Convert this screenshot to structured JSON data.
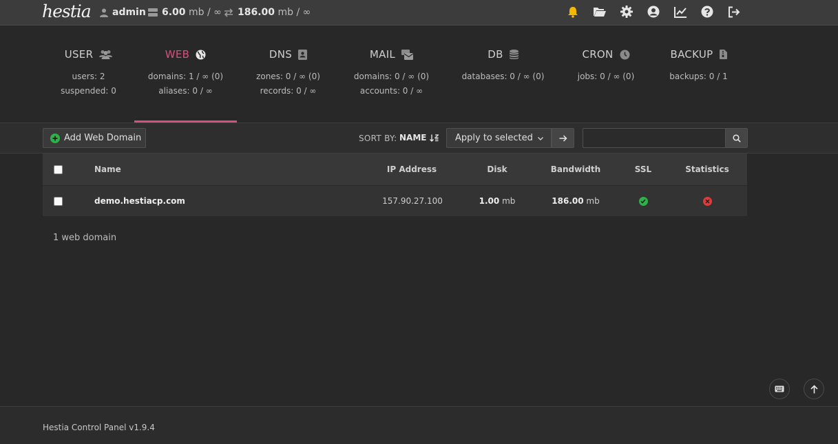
{
  "app": {
    "logo_text": "hestia",
    "footer": "Hestia Control Panel v1.9.4"
  },
  "topbar": {
    "user": "admin",
    "disk_value": "6.00",
    "disk_rest": "mb / ∞",
    "bandwidth_value": "186.00",
    "bandwidth_rest": "mb / ∞",
    "icons": [
      "bell-icon",
      "folder-open-icon",
      "gear-icon",
      "user-circle-icon",
      "chart-line-icon",
      "help-icon",
      "logout-icon"
    ],
    "bell_color": "#f5b700"
  },
  "tabs": [
    {
      "title": "USER",
      "lines": [
        "users: 2",
        "suspended: 0"
      ]
    },
    {
      "title": "WEB",
      "lines": [
        "domains: 1 / ∞ (0)",
        "aliases: 0 / ∞"
      ]
    },
    {
      "title": "DNS",
      "lines": [
        "zones: 0 / ∞ (0)",
        "records: 0 / ∞"
      ]
    },
    {
      "title": "MAIL",
      "lines": [
        "domains: 0 / ∞ (0)",
        "accounts: 0 / ∞"
      ]
    },
    {
      "title": "DB",
      "lines": [
        "databases: 0 / ∞ (0)"
      ]
    },
    {
      "title": "CRON",
      "lines": [
        "jobs: 0 / ∞ (0)"
      ]
    },
    {
      "title": "BACKUP",
      "lines": [
        "backups: 0 / 1"
      ]
    }
  ],
  "active_tab": "WEB",
  "accent_color": "#d94f7c",
  "toolbar": {
    "add_label": "Add Web Domain",
    "sort_label": "SORT BY:",
    "sort_value": "NAME",
    "bulk_action": "Apply to selected",
    "search_placeholder": ""
  },
  "table": {
    "headers": {
      "name": "Name",
      "ip": "IP Address",
      "disk": "Disk",
      "bandwidth": "Bandwidth",
      "ssl": "SSL",
      "statistics": "Statistics"
    },
    "rows": [
      {
        "name": "demo.hestiacp.com",
        "ip": "157.90.27.100",
        "disk_value": "1.00",
        "disk_unit": "mb",
        "bandwidth_value": "186.00",
        "bandwidth_unit": "mb",
        "ssl": "enabled",
        "statistics": "disabled"
      }
    ]
  },
  "summary": "1 web domain",
  "status_colors": {
    "ok": "#2fb14a",
    "error": "#e03a3a"
  }
}
